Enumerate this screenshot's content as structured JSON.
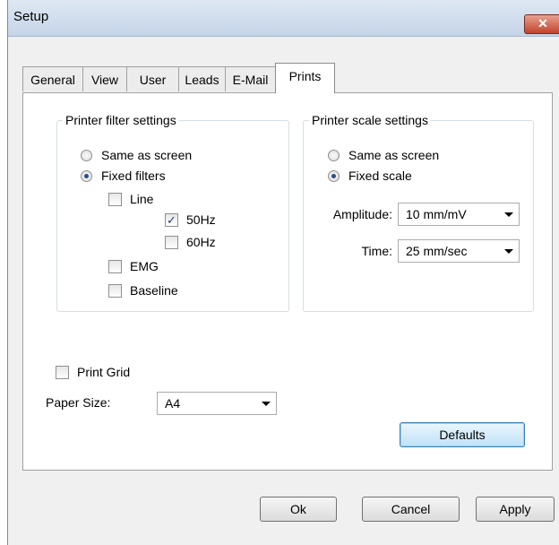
{
  "window": {
    "title": "Setup",
    "close_glyph": "✕"
  },
  "tabs": [
    "General",
    "View",
    "User",
    "Leads",
    "E-Mail",
    "Prints"
  ],
  "active_tab": "Prints",
  "filter_group": {
    "legend": "Printer filter settings",
    "radio_same": "Same as screen",
    "radio_fixed": "Fixed filters",
    "line": "Line",
    "hz50": "50Hz",
    "hz60": "60Hz",
    "emg": "EMG",
    "baseline": "Baseline",
    "selected": "Fixed filters",
    "checked": [
      "50Hz"
    ]
  },
  "scale_group": {
    "legend": "Printer scale settings",
    "radio_same": "Same as screen",
    "radio_fixed": "Fixed scale",
    "selected": "Fixed scale",
    "amplitude_label": "Amplitude:",
    "amplitude_value": "10 mm/mV",
    "time_label": "Time:",
    "time_value": "25 mm/sec"
  },
  "print_grid": {
    "label": "Print Grid",
    "checked": false
  },
  "paper_size": {
    "label": "Paper Size:",
    "value": "A4"
  },
  "buttons": {
    "defaults": "Defaults",
    "ok": "Ok",
    "cancel": "Cancel",
    "apply": "Apply"
  },
  "icons": {
    "close": "close-icon",
    "dropdown": "chevron-down-icon",
    "check": "checkmark-icon"
  },
  "colors": {
    "accent": "#2a4f86",
    "close_button": "#c0442b",
    "titlebar": "#c4d4e8"
  }
}
